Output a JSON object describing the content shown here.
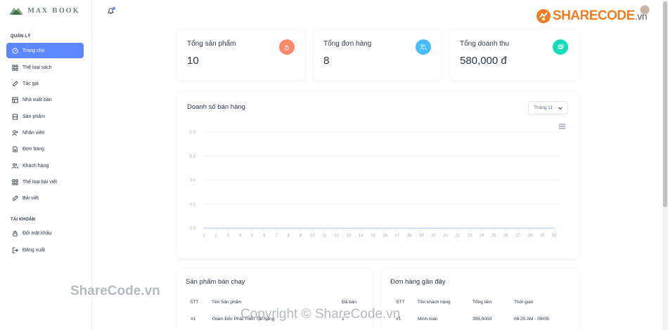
{
  "app": {
    "logo_text": "MAX BOOK"
  },
  "sidebar": {
    "section_manage": "QUẢN LÝ",
    "section_account": "TÀI KHOẢN",
    "items": [
      {
        "label": "Trang chủ",
        "icon": "dashboard-icon",
        "active": true
      },
      {
        "label": "Thể loại sách",
        "icon": "grid-icon"
      },
      {
        "label": "Tác giả",
        "icon": "pencil-icon"
      },
      {
        "label": "Nhà xuất bản",
        "icon": "table-icon"
      },
      {
        "label": "Sản phẩm",
        "icon": "box-icon"
      },
      {
        "label": "Nhân viên",
        "icon": "user-plus-icon"
      },
      {
        "label": "Đơn hàng",
        "icon": "document-icon"
      },
      {
        "label": "Khách hàng",
        "icon": "users-icon"
      },
      {
        "label": "Thể loại bài viết",
        "icon": "grid-icon"
      },
      {
        "label": "Bài viết",
        "icon": "pencil-icon"
      }
    ],
    "account_items": [
      {
        "label": "Đổi mật khẩu",
        "icon": "lock-icon"
      },
      {
        "label": "Đăng xuất",
        "icon": "logout-icon"
      }
    ]
  },
  "header": {
    "brand": "SHARECODE",
    "brand_suffix": ".vn"
  },
  "stats": [
    {
      "title": "Tổng sản phẩm",
      "value": "10",
      "icon": "hand-icon",
      "color": "#fa896b"
    },
    {
      "title": "Tổng đơn hàng",
      "value": "8",
      "icon": "users-icon",
      "color": "#49beff"
    },
    {
      "title": "Tổng doanh thu",
      "value": "580,000 đ",
      "icon": "money-icon",
      "color": "#13deb9"
    }
  ],
  "sales": {
    "title": "Doanh số bán hàng",
    "month_selected": "Tháng 11"
  },
  "chart_data": {
    "type": "line",
    "title": "",
    "x": [
      1,
      2,
      3,
      4,
      5,
      6,
      7,
      8,
      9,
      10,
      11,
      12,
      13,
      14,
      15,
      16,
      17,
      18,
      19,
      20,
      21,
      22,
      23,
      24,
      25,
      26,
      27,
      28,
      29,
      30
    ],
    "series": [
      {
        "values": [
          0,
          0,
          0,
          0,
          0,
          0,
          0,
          0,
          0,
          0,
          0,
          0,
          0,
          0,
          0,
          0,
          0,
          0,
          0,
          0,
          0,
          0,
          0,
          0,
          0,
          0,
          0,
          0,
          0,
          0
        ]
      }
    ],
    "y_ticks": [
      "0.0",
      "0.0",
      "0.0",
      "0.0",
      "0.0"
    ],
    "grid": true
  },
  "best_sellers": {
    "title": "Sản phẩm bán chạy",
    "columns": [
      "STT",
      "Tên Sản phẩm",
      "Đã bán"
    ],
    "rows": [
      [
        "#1",
        "Giám Đốc Phát Triển Tài Năng",
        "1"
      ]
    ]
  },
  "recent_orders": {
    "title": "Đơn hàng gần đây",
    "columns": [
      "STT",
      "Tên khách hàng",
      "Tổng tiền",
      "Thời gian"
    ],
    "rows": [
      [
        "#1",
        "Minh toàn",
        "395,000đ",
        "06:25 AM - 09/05"
      ]
    ]
  },
  "watermarks": {
    "a": "ShareCode.vn",
    "b": "Copyright © ShareCode.vn"
  }
}
